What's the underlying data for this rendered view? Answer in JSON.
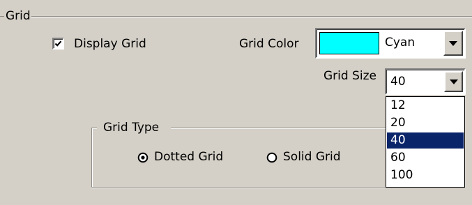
{
  "group": {
    "title": "Grid"
  },
  "display_grid": {
    "label": "Display Grid",
    "checked": true
  },
  "grid_color": {
    "label": "Grid Color",
    "value": "Cyan",
    "swatch_color": "#00ffff"
  },
  "grid_size": {
    "label": "Grid Size",
    "value": "40",
    "options": [
      "12",
      "20",
      "40",
      "60",
      "100"
    ],
    "selected_index": 2
  },
  "grid_type": {
    "title": "Grid Type",
    "options": [
      {
        "label": "Dotted Grid",
        "selected": true
      },
      {
        "label": "Solid Grid",
        "selected": false
      }
    ]
  },
  "colors": {
    "selection": "#0a246a",
    "background": "#d4d0c8"
  }
}
